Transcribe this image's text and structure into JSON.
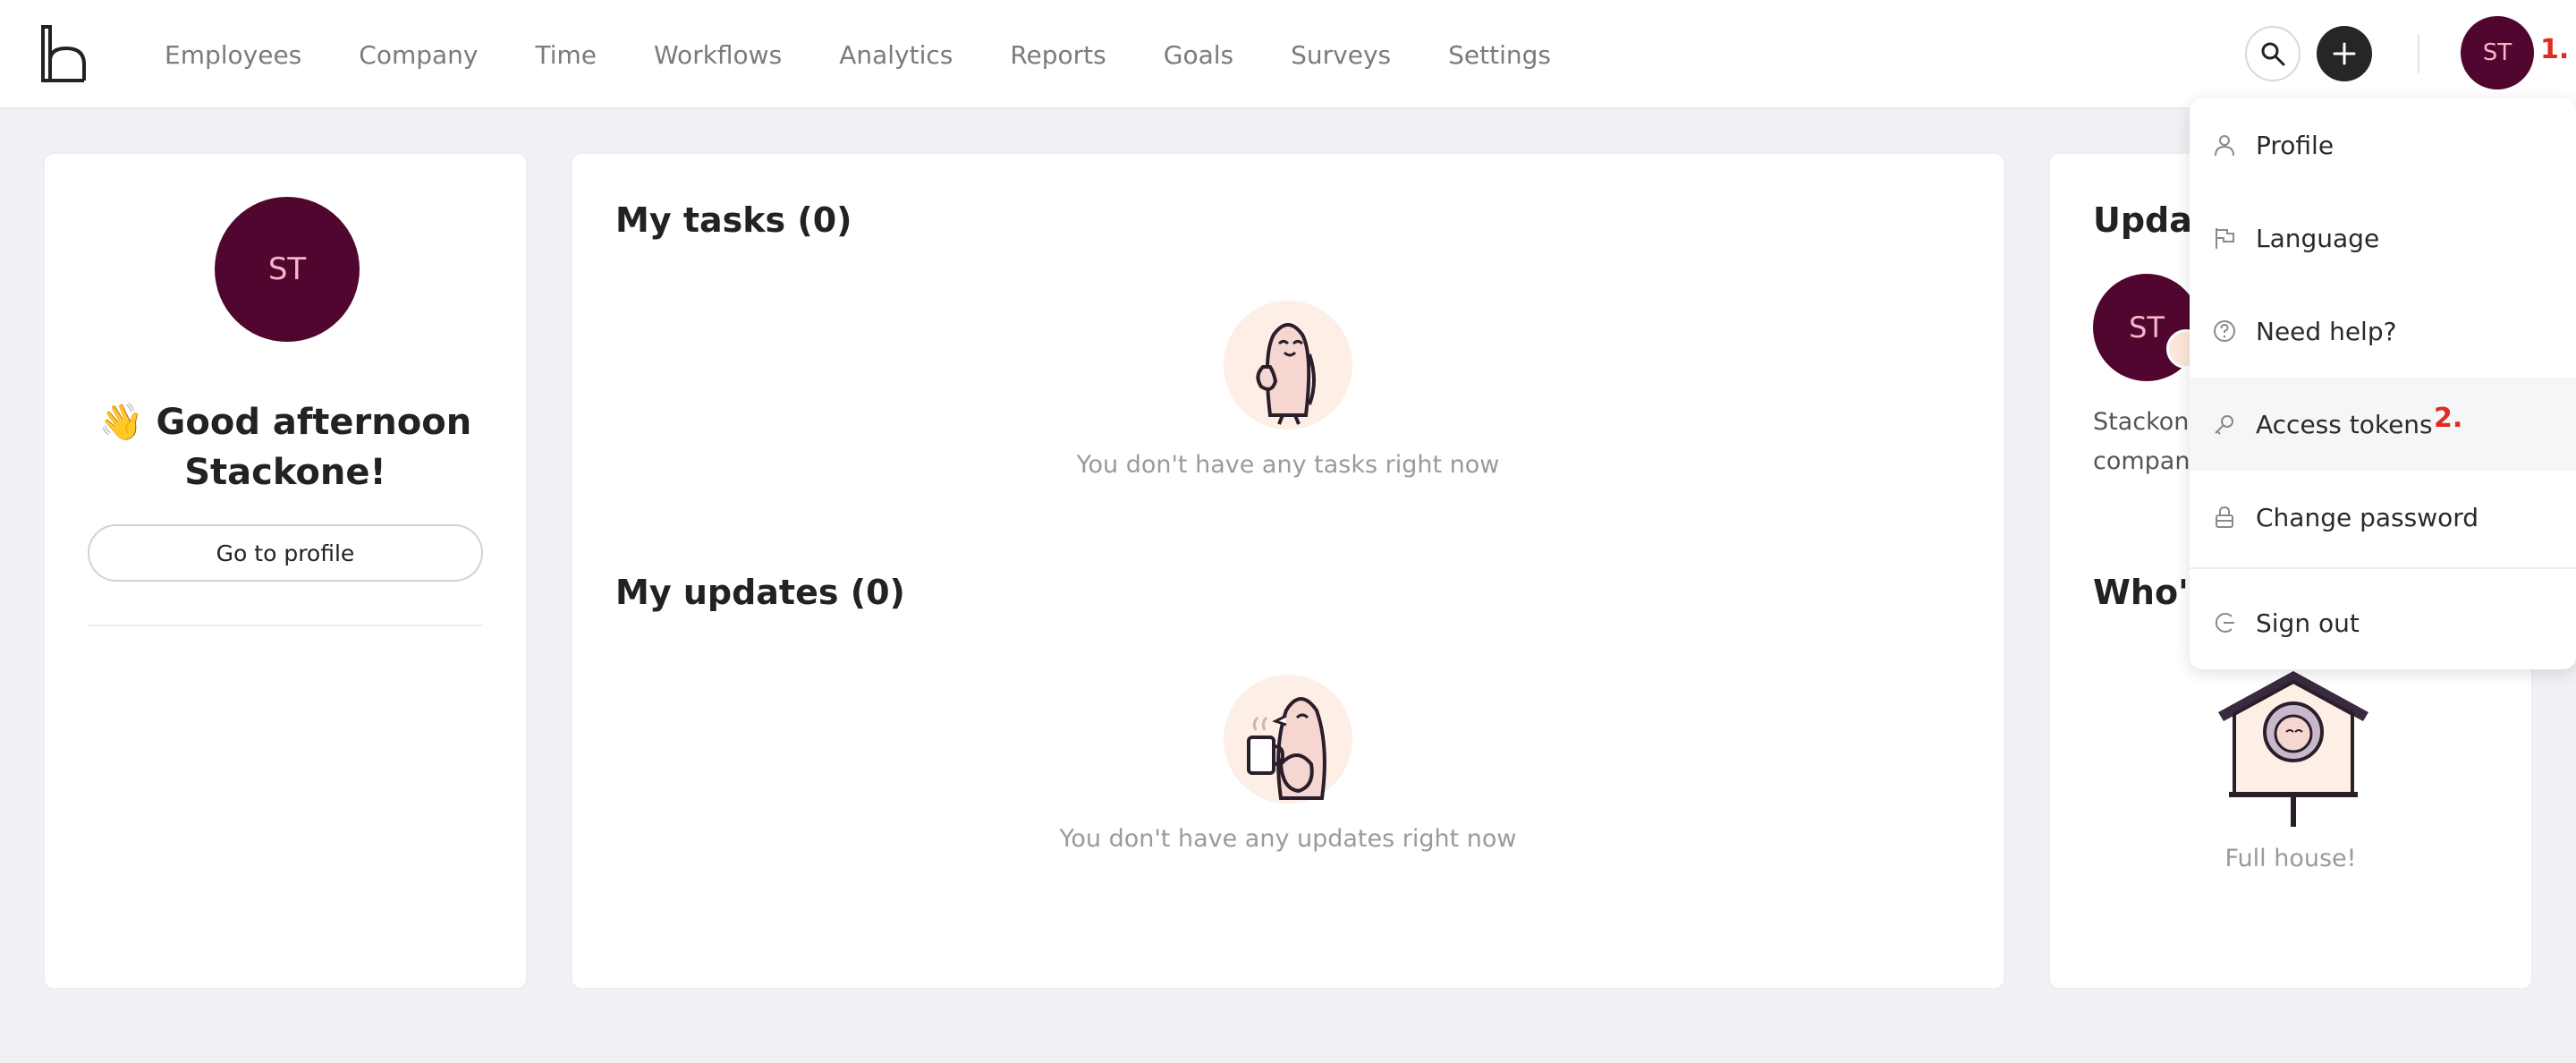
{
  "nav": {
    "items": [
      {
        "label": "Employees"
      },
      {
        "label": "Company"
      },
      {
        "label": "Time"
      },
      {
        "label": "Workflows"
      },
      {
        "label": "Analytics"
      },
      {
        "label": "Reports"
      },
      {
        "label": "Goals"
      },
      {
        "label": "Surveys"
      },
      {
        "label": "Settings"
      }
    ]
  },
  "user": {
    "initials": "ST"
  },
  "annotations": {
    "step1": "1.",
    "step2": "2."
  },
  "greeting_card": {
    "greeting": "👋 Good afternoon Stackone!",
    "profile_button": "Go to profile"
  },
  "tasks": {
    "title": "My tasks (0)",
    "empty": "You don't have any tasks right now"
  },
  "updates": {
    "title": "My updates (0)",
    "empty": "You don't have any updates right now"
  },
  "right_card": {
    "title_visible": "Upda",
    "text_line1": "Stackone",
    "text_line2": "company",
    "whos_visible": "Who's",
    "full_house": "Full house!"
  },
  "menu": {
    "items": [
      {
        "label": "Profile",
        "icon": "user-icon"
      },
      {
        "label": "Language",
        "icon": "flag-icon"
      },
      {
        "label": "Need help?",
        "icon": "help-icon"
      },
      {
        "label": "Access tokens",
        "icon": "key-icon"
      },
      {
        "label": "Change password",
        "icon": "lock-icon"
      },
      {
        "label": "Sign out",
        "icon": "sign-out-icon"
      }
    ]
  },
  "colors": {
    "avatar_bg": "#50062f",
    "avatar_text": "#f2b8c8",
    "annotation": "#e02b20",
    "page_bg": "#f0f1f4"
  }
}
